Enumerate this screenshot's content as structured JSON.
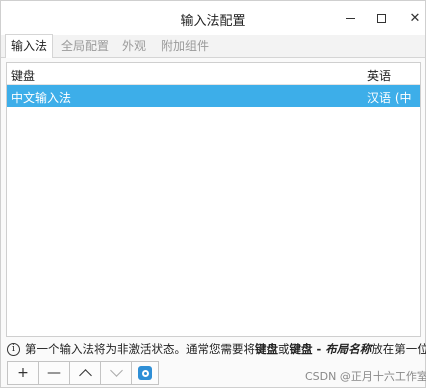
{
  "window": {
    "title": "输入法配置"
  },
  "tabs": [
    {
      "label": "输入法",
      "active": true
    },
    {
      "label": "全局配置",
      "active": false
    },
    {
      "label": "外观",
      "active": false
    },
    {
      "label": "附加组件",
      "active": false
    }
  ],
  "list": {
    "columns": {
      "keyboard": "键盘",
      "language": "英语"
    },
    "rows": [
      {
        "name": "中文输入法",
        "language": "汉语 (中国)",
        "selected": true
      }
    ]
  },
  "info": {
    "icon": "info-icon",
    "text_before": "第一个输入法将为非激活状态。通常您需要将",
    "bold1": "键盘",
    "mid": "或",
    "bold2": "键盘 - ",
    "italic": "布局名称",
    "text_after": "放在第一位。"
  },
  "toolbar": {
    "add": "+",
    "remove": "—",
    "up_icon": "chevron-up-icon",
    "down_icon": "chevron-down-icon",
    "config_icon": "configure-icon"
  },
  "watermark": "CSDN @正月十六工作室",
  "colors": {
    "selection": "#3daee9",
    "config_icon": "#2f8fd6"
  }
}
